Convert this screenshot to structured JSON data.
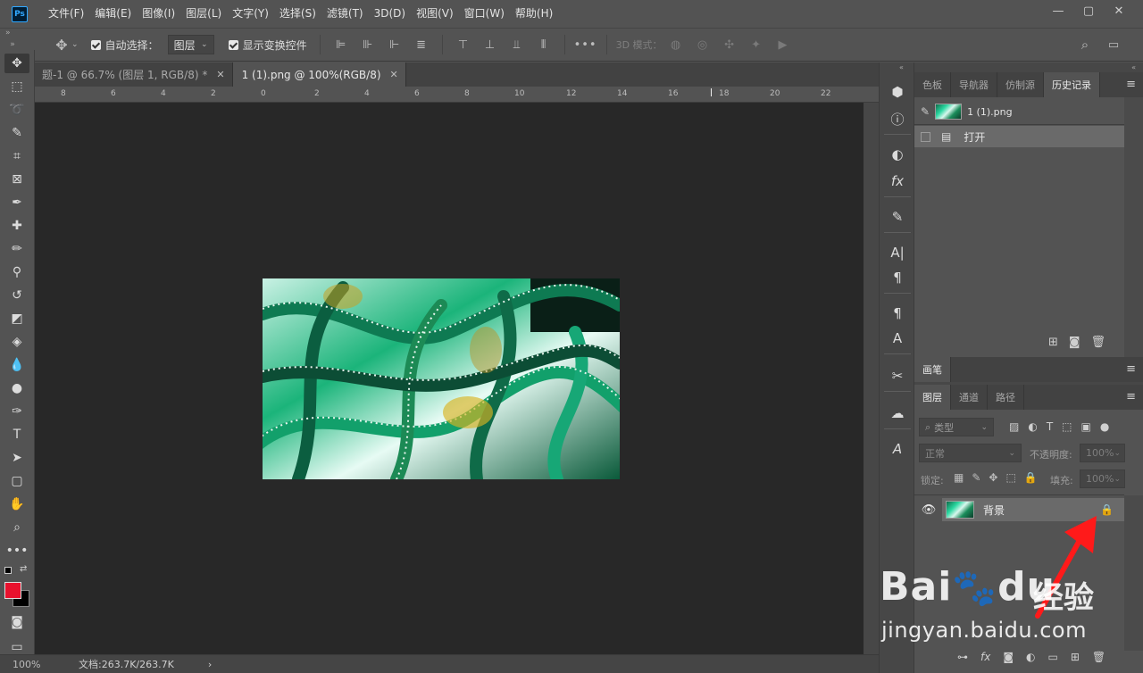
{
  "app": {
    "logo": "Ps"
  },
  "menu": [
    "文件(F)",
    "编辑(E)",
    "图像(I)",
    "图层(L)",
    "文字(Y)",
    "选择(S)",
    "滤镜(T)",
    "3D(D)",
    "视图(V)",
    "窗口(W)",
    "帮助(H)"
  ],
  "window_controls": {
    "minimize": "—",
    "maximize": "▢",
    "close": "✕"
  },
  "options": {
    "auto_select_label": "自动选择：",
    "auto_select_value": "图层",
    "show_transform_label": "显示变换控件",
    "more": "•••",
    "mode_3d_label": "3D 模式："
  },
  "tabs": [
    {
      "label": "题-1 @ 66.7% (图层 1, RGB/8) *",
      "active": false
    },
    {
      "label": "1 (1).png @ 100%(RGB/8)",
      "active": true
    }
  ],
  "ruler_top": [
    "8",
    "6",
    "4",
    "2",
    "0",
    "2",
    "4",
    "6",
    "8",
    "10",
    "12",
    "14",
    "16",
    "18",
    "20",
    "22"
  ],
  "status": {
    "zoom": "100%",
    "doc": "文档:263.7K/263.7K",
    "arrow": "›"
  },
  "panels": {
    "top_tabs": [
      "色板",
      "导航器",
      "仿制源",
      "历史记录"
    ],
    "history": {
      "snapshot_label": "1 (1).png",
      "items": [
        "打开"
      ]
    },
    "brush_tab": "画笔",
    "layer_tabs": [
      "图层",
      "通道",
      "路径"
    ],
    "layers": {
      "filter_label": "类型",
      "blend_mode": "正常",
      "opacity_label": "不透明度:",
      "opacity_value": "100%",
      "lock_label": "锁定:",
      "fill_label": "填充:",
      "fill_value": "100%",
      "items": [
        {
          "name": "背景",
          "locked": true,
          "visible": true
        }
      ]
    }
  },
  "watermark": {
    "brand": "Bai",
    "brand2": "du",
    "cn": "经验",
    "url": "jingyan.baidu.com"
  },
  "colors": {
    "foreground": "#e8112d",
    "background": "#000000",
    "accent": "#31a8ff"
  }
}
